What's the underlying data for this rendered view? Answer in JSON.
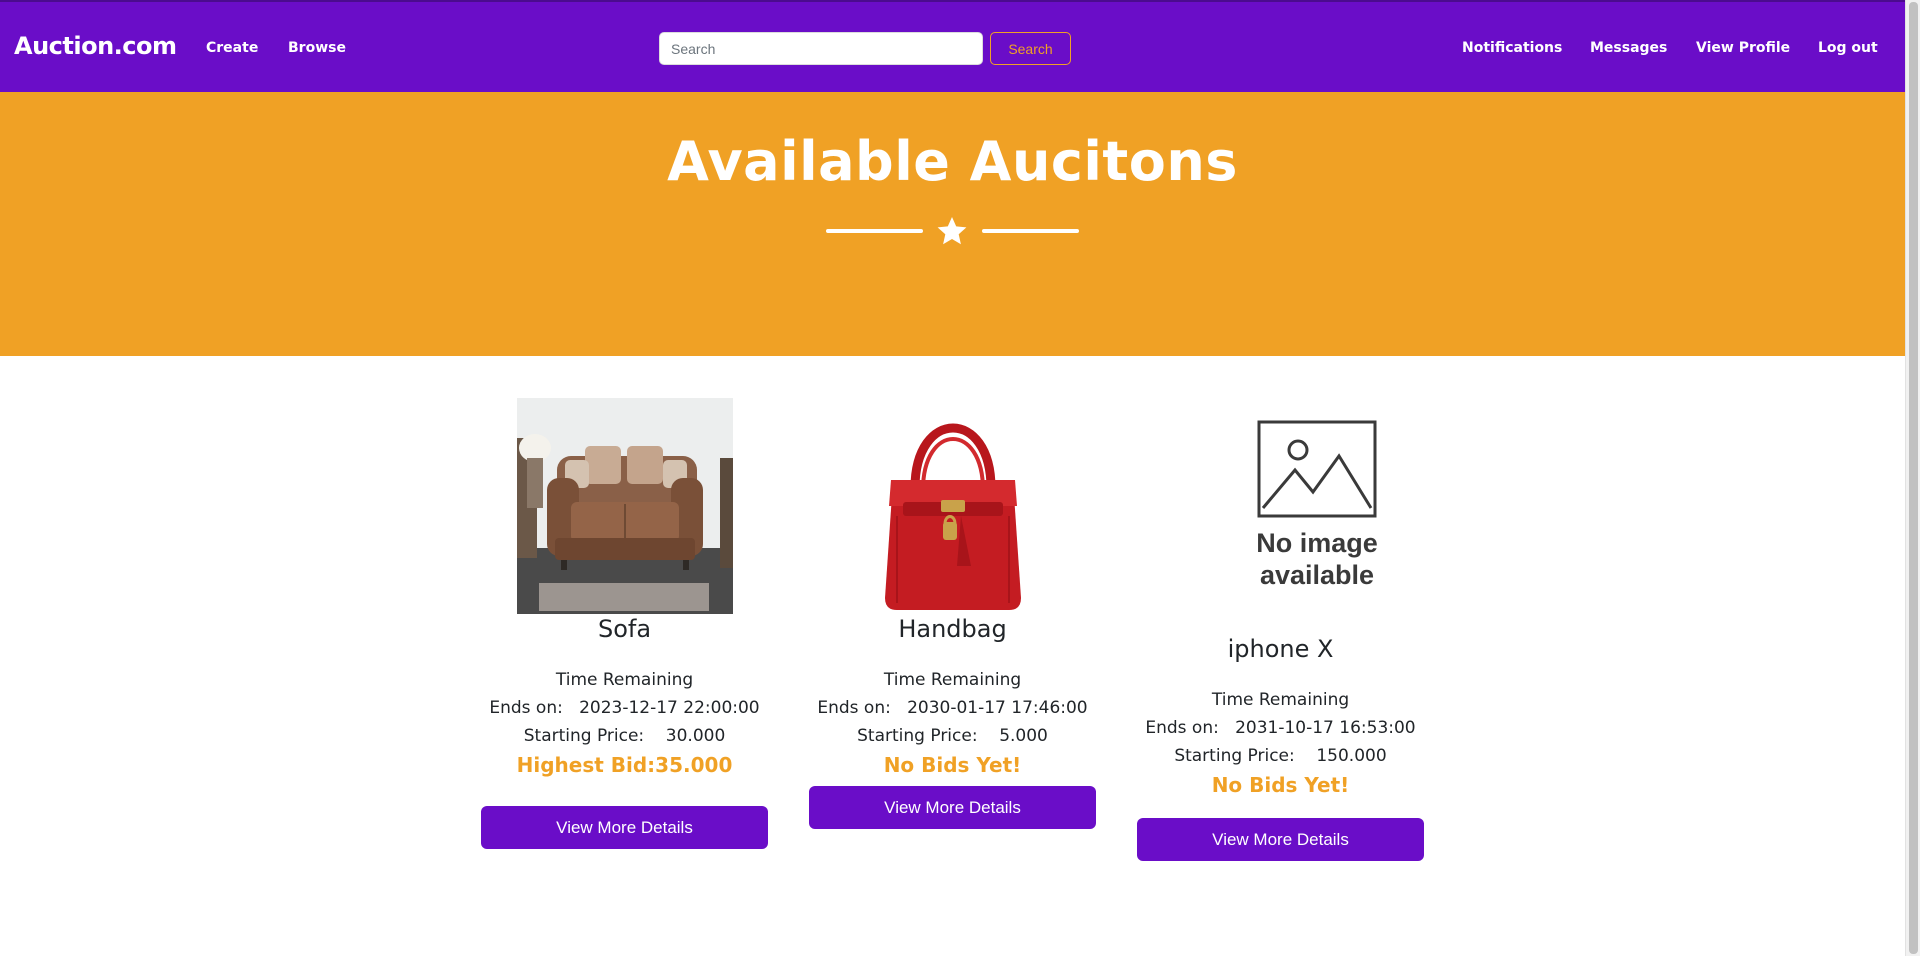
{
  "navbar": {
    "brand": "Auction.com",
    "links_left": [
      "Create",
      "Browse"
    ],
    "search": {
      "placeholder": "Search",
      "value": "",
      "button_label": "Search"
    },
    "links_right": [
      "Notifications",
      "Messages",
      "View Profile",
      "Log out"
    ]
  },
  "hero": {
    "title": "Available Aucitons",
    "divider_icon": "star-icon"
  },
  "colors": {
    "primary": "#6a0dc8",
    "accent": "#f0a125",
    "text": "#212529"
  },
  "auctions": [
    {
      "name": "Sofa",
      "image": "sofa-photo",
      "time_label": "Time Remaining",
      "ends_label": "Ends on:",
      "ends_value": "2023-12-17 22:00:00",
      "price_label": "Starting Price:",
      "price_value": "30.000",
      "bid_text": "Highest Bid:35.000",
      "button_label": "View More Details"
    },
    {
      "name": "Handbag",
      "image": "handbag-photo",
      "time_label": "Time Remaining",
      "ends_label": "Ends on:",
      "ends_value": "2030-01-17 17:46:00",
      "price_label": "Starting Price:",
      "price_value": "5.000",
      "bid_text": "No Bids Yet!",
      "button_label": "View More Details"
    },
    {
      "name": "iphone X",
      "image": "no-image-placeholder",
      "placeholder_text": [
        "No image",
        "available"
      ],
      "time_label": "Time Remaining",
      "ends_label": "Ends on:",
      "ends_value": "2031-10-17 16:53:00",
      "price_label": "Starting Price:",
      "price_value": "150.000",
      "bid_text": "No Bids Yet!",
      "button_label": "View More Details"
    }
  ]
}
